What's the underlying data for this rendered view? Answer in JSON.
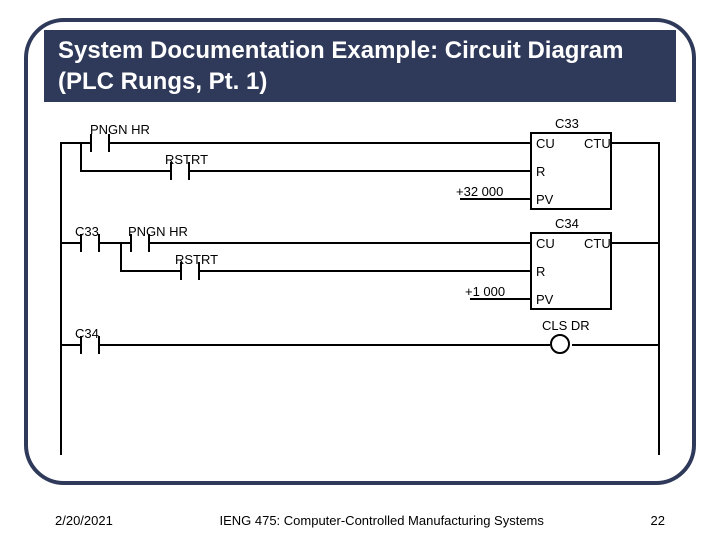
{
  "title": "System Documentation Example: Circuit Diagram (PLC Rungs, Pt. 1)",
  "rung1": {
    "counter_id": "C33",
    "input1": "PNGN HR",
    "input2": "RSTRT",
    "preset_label": "+32 000",
    "cu": "CU",
    "r": "R",
    "pv": "PV",
    "type": "CTU"
  },
  "rung2": {
    "left_contact": "C33",
    "counter_id": "C34",
    "input1": "PNGN HR",
    "input2": "RSTRT",
    "preset_label": "+1 000",
    "cu": "CU",
    "r": "R",
    "pv": "PV",
    "type": "CTU"
  },
  "rung3": {
    "left_contact": "C34",
    "coil": "CLS DR"
  },
  "footer": {
    "date": "2/20/2021",
    "course": "IENG 475: Computer-Controlled Manufacturing Systems",
    "slide_no": "22"
  }
}
